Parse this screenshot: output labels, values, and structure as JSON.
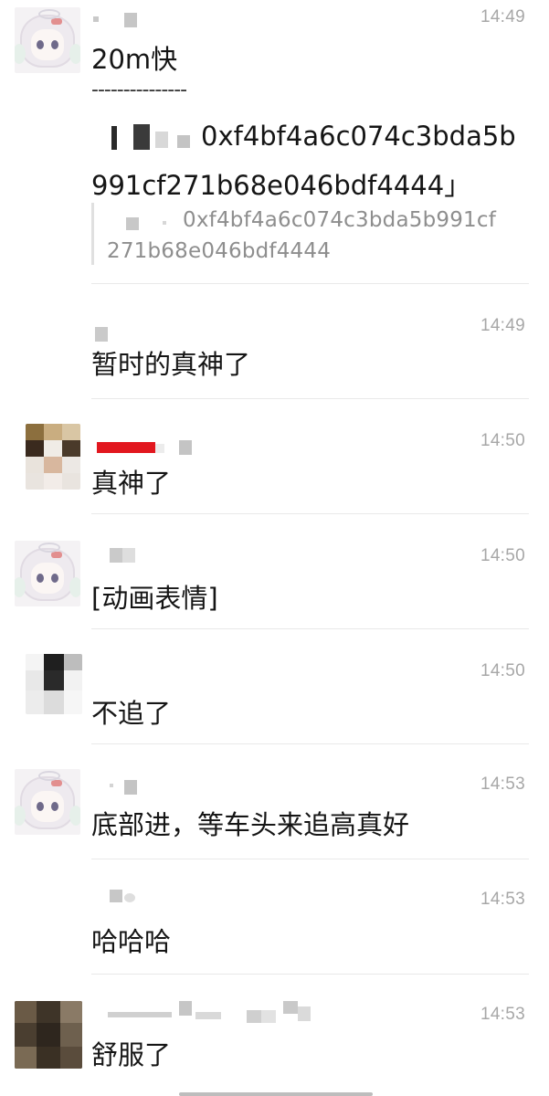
{
  "messages": [
    {
      "time": "14:49",
      "text": "20m快",
      "separator": "---------------",
      "reply_line1": "0xf4bf4a6c074c3bda5b",
      "reply_line2": "991cf271b68e046bdf4444」",
      "quote_line1": "0xf4bf4a6c074c3bda5b991cf",
      "quote_line2": "271b68e046bdf4444"
    },
    {
      "time": "14:49",
      "text": "暂时的真神了"
    },
    {
      "time": "14:50",
      "text": "真神了"
    },
    {
      "time": "14:50",
      "text": "[动画表情]"
    },
    {
      "time": "14:50",
      "text": "不追了"
    },
    {
      "time": "14:53",
      "text": "底部进，等车头来追高真好"
    },
    {
      "time": "14:53",
      "text": "哈哈哈"
    },
    {
      "time": "14:53",
      "text": "舒服了"
    }
  ],
  "colors": {
    "time": "#a7a7a7",
    "text": "#151515",
    "divider": "#e9e9e9",
    "redaction_red": "#e2171f"
  },
  "icons": [
    "anime-avatar",
    "pixelated-avatar"
  ]
}
